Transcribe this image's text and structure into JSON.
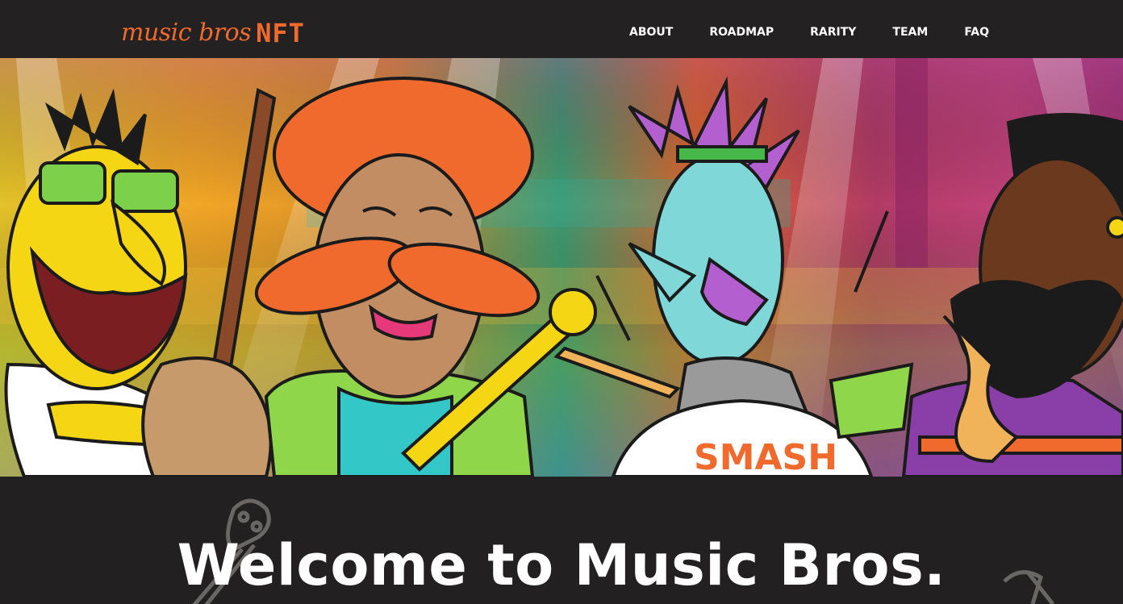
{
  "brand": {
    "logo_script": "music bros",
    "logo_accent": "NFT",
    "accent_color": "#ef6a2c"
  },
  "nav": {
    "items": [
      {
        "label": "ABOUT"
      },
      {
        "label": "ROADMAP"
      },
      {
        "label": "RARITY"
      },
      {
        "label": "TEAM"
      },
      {
        "label": "FAQ"
      }
    ]
  },
  "hero": {
    "illustration": "cartoon-band-banner",
    "drum_text": "SMASH"
  },
  "welcome": {
    "title": "Welcome to Music Bros."
  },
  "colors": {
    "background": "#222020",
    "nav_text": "#ffffff"
  }
}
